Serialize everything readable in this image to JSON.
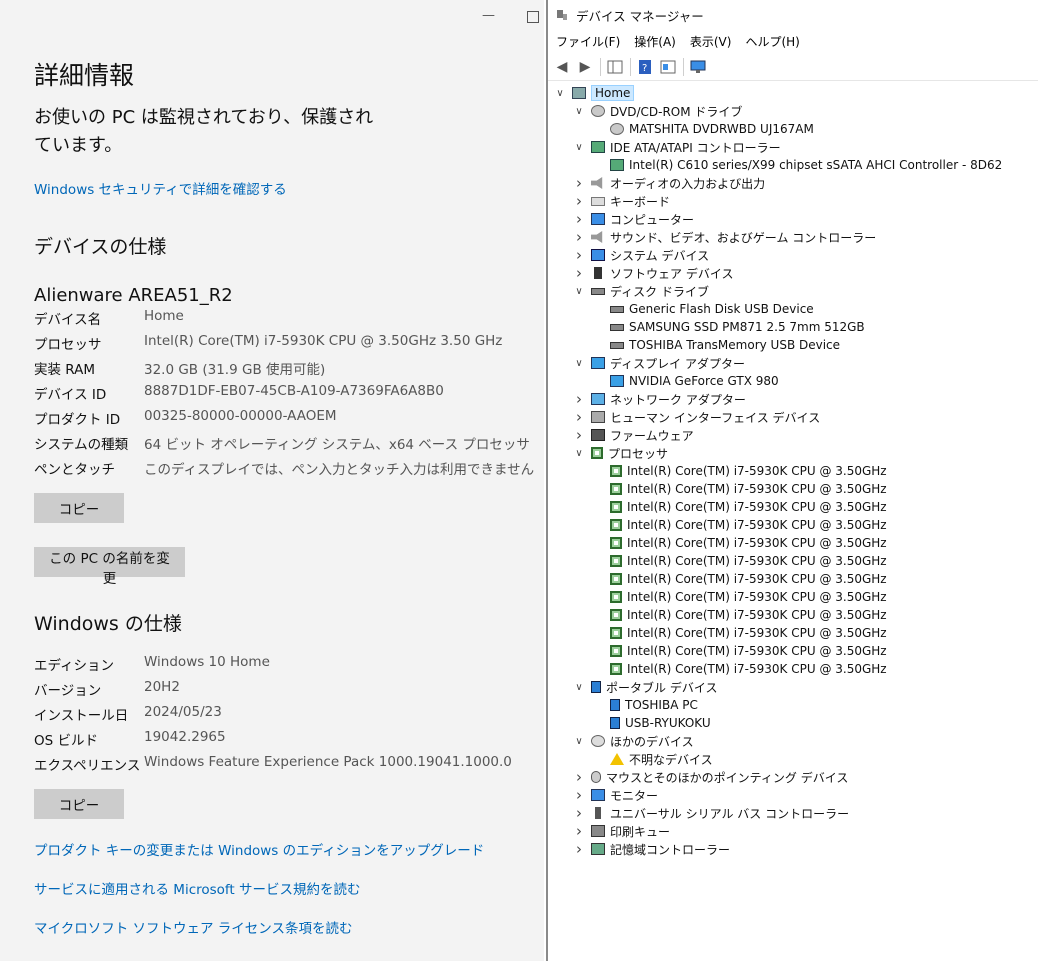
{
  "settings": {
    "title": "詳細情報",
    "status": "お使いの PC は監視されており、保護されています。",
    "security_link": "Windows セキュリティで詳細を確認する",
    "device_spec_heading": "デバイスの仕様",
    "device_model": "Alienware AREA51_R2",
    "device_specs": [
      {
        "label": "デバイス名",
        "value": "Home"
      },
      {
        "label": "プロセッサ",
        "value": "Intel(R) Core(TM) i7-5930K CPU @ 3.50GHz   3.50 GHz"
      },
      {
        "label": "実装 RAM",
        "value": "32.0 GB (31.9 GB 使用可能)"
      },
      {
        "label": "デバイス ID",
        "value": "8887D1DF-EB07-45CB-A109-A7369FA6A8B0"
      },
      {
        "label": "プロダクト ID",
        "value": "00325-80000-00000-AAOEM"
      },
      {
        "label": "システムの種類",
        "value": "64 ビット オペレーティング システム、x64 ベース プロセッサ"
      },
      {
        "label": "ペンとタッチ",
        "value": "このディスプレイでは、ペン入力とタッチ入力は利用できません"
      }
    ],
    "copy_button": "コピー",
    "rename_button": "この PC の名前を変更",
    "windows_spec_heading": "Windows の仕様",
    "windows_specs": [
      {
        "label": "エディション",
        "value": "Windows 10 Home"
      },
      {
        "label": "バージョン",
        "value": "20H2"
      },
      {
        "label": "インストール日",
        "value": "2024/05/23"
      },
      {
        "label": "OS ビルド",
        "value": "19042.2965"
      },
      {
        "label": "エクスペリエンス",
        "value": "Windows Feature Experience Pack 1000.19041.1000.0"
      }
    ],
    "copy_button_2": "コピー",
    "links": [
      "プロダクト キーの変更または Windows のエディションをアップグレード",
      "サービスに適用される Microsoft サービス規約を読む",
      "マイクロソフト ソフトウェア ライセンス条項を読む"
    ],
    "window_controls": {
      "minimize": "—"
    }
  },
  "device_manager": {
    "title": "デバイス マネージャー",
    "menu": [
      "ファイル(F)",
      "操作(A)",
      "表示(V)",
      "ヘルプ(H)"
    ],
    "tree": [
      {
        "label": "Home",
        "level": 0,
        "expander": "expanded",
        "icon": "computer-root-icon",
        "selected": true
      },
      {
        "label": "DVD/CD-ROM ドライブ",
        "level": 1,
        "expander": "expanded",
        "icon": "dvd-drive-icon"
      },
      {
        "label": "MATSHITA DVDRWBD UJ167AM",
        "level": 2,
        "expander": "none",
        "icon": "dvd-drive-icon"
      },
      {
        "label": "IDE ATA/ATAPI コントローラー",
        "level": 1,
        "expander": "expanded",
        "icon": "ide-controller-icon"
      },
      {
        "label": "Intel(R) C610 series/X99 chipset sSATA AHCI Controller - 8D62",
        "level": 2,
        "expander": "none",
        "icon": "ide-controller-icon"
      },
      {
        "label": "オーディオの入力および出力",
        "level": 1,
        "expander": "collapsed",
        "icon": "speaker-icon"
      },
      {
        "label": "キーボード",
        "level": 1,
        "expander": "collapsed",
        "icon": "keyboard-icon"
      },
      {
        "label": "コンピューター",
        "level": 1,
        "expander": "collapsed",
        "icon": "computer-icon"
      },
      {
        "label": "サウンド、ビデオ、およびゲーム コントローラー",
        "level": 1,
        "expander": "collapsed",
        "icon": "speaker-icon"
      },
      {
        "label": "システム デバイス",
        "level": 1,
        "expander": "collapsed",
        "icon": "system-device-icon"
      },
      {
        "label": "ソフトウェア デバイス",
        "level": 1,
        "expander": "collapsed",
        "icon": "software-device-icon"
      },
      {
        "label": "ディスク ドライブ",
        "level": 1,
        "expander": "expanded",
        "icon": "disk-drive-icon"
      },
      {
        "label": "Generic Flash Disk USB Device",
        "level": 2,
        "expander": "none",
        "icon": "disk-drive-icon"
      },
      {
        "label": "SAMSUNG SSD PM871 2.5 7mm 512GB",
        "level": 2,
        "expander": "none",
        "icon": "disk-drive-icon"
      },
      {
        "label": "TOSHIBA TransMemory USB Device",
        "level": 2,
        "expander": "none",
        "icon": "disk-drive-icon"
      },
      {
        "label": "ディスプレイ アダプター",
        "level": 1,
        "expander": "expanded",
        "icon": "display-adapter-icon"
      },
      {
        "label": "NVIDIA GeForce GTX 980",
        "level": 2,
        "expander": "none",
        "icon": "display-adapter-icon"
      },
      {
        "label": "ネットワーク アダプター",
        "level": 1,
        "expander": "collapsed",
        "icon": "network-adapter-icon"
      },
      {
        "label": "ヒューマン インターフェイス デバイス",
        "level": 1,
        "expander": "collapsed",
        "icon": "hid-icon"
      },
      {
        "label": "ファームウェア",
        "level": 1,
        "expander": "collapsed",
        "icon": "firmware-icon"
      },
      {
        "label": "プロセッサ",
        "level": 1,
        "expander": "expanded",
        "icon": "processor-icon"
      },
      {
        "label": "Intel(R) Core(TM) i7-5930K CPU @ 3.50GHz",
        "level": 2,
        "expander": "none",
        "icon": "processor-icon"
      },
      {
        "label": "Intel(R) Core(TM) i7-5930K CPU @ 3.50GHz",
        "level": 2,
        "expander": "none",
        "icon": "processor-icon"
      },
      {
        "label": "Intel(R) Core(TM) i7-5930K CPU @ 3.50GHz",
        "level": 2,
        "expander": "none",
        "icon": "processor-icon"
      },
      {
        "label": "Intel(R) Core(TM) i7-5930K CPU @ 3.50GHz",
        "level": 2,
        "expander": "none",
        "icon": "processor-icon"
      },
      {
        "label": "Intel(R) Core(TM) i7-5930K CPU @ 3.50GHz",
        "level": 2,
        "expander": "none",
        "icon": "processor-icon"
      },
      {
        "label": "Intel(R) Core(TM) i7-5930K CPU @ 3.50GHz",
        "level": 2,
        "expander": "none",
        "icon": "processor-icon"
      },
      {
        "label": "Intel(R) Core(TM) i7-5930K CPU @ 3.50GHz",
        "level": 2,
        "expander": "none",
        "icon": "processor-icon"
      },
      {
        "label": "Intel(R) Core(TM) i7-5930K CPU @ 3.50GHz",
        "level": 2,
        "expander": "none",
        "icon": "processor-icon"
      },
      {
        "label": "Intel(R) Core(TM) i7-5930K CPU @ 3.50GHz",
        "level": 2,
        "expander": "none",
        "icon": "processor-icon"
      },
      {
        "label": "Intel(R) Core(TM) i7-5930K CPU @ 3.50GHz",
        "level": 2,
        "expander": "none",
        "icon": "processor-icon"
      },
      {
        "label": "Intel(R) Core(TM) i7-5930K CPU @ 3.50GHz",
        "level": 2,
        "expander": "none",
        "icon": "processor-icon"
      },
      {
        "label": "Intel(R) Core(TM) i7-5930K CPU @ 3.50GHz",
        "level": 2,
        "expander": "none",
        "icon": "processor-icon"
      },
      {
        "label": "ポータブル デバイス",
        "level": 1,
        "expander": "expanded",
        "icon": "portable-device-icon"
      },
      {
        "label": "TOSHIBA PC",
        "level": 2,
        "expander": "none",
        "icon": "portable-device-icon"
      },
      {
        "label": "USB-RYUKOKU",
        "level": 2,
        "expander": "none",
        "icon": "portable-device-icon"
      },
      {
        "label": "ほかのデバイス",
        "level": 1,
        "expander": "expanded",
        "icon": "other-device-icon"
      },
      {
        "label": "不明なデバイス",
        "level": 2,
        "expander": "none",
        "icon": "warning-icon"
      },
      {
        "label": "マウスとそのほかのポインティング デバイス",
        "level": 1,
        "expander": "collapsed",
        "icon": "mouse-icon"
      },
      {
        "label": "モニター",
        "level": 1,
        "expander": "collapsed",
        "icon": "monitor-icon"
      },
      {
        "label": "ユニバーサル シリアル バス コントローラー",
        "level": 1,
        "expander": "collapsed",
        "icon": "usb-icon"
      },
      {
        "label": "印刷キュー",
        "level": 1,
        "expander": "collapsed",
        "icon": "printer-icon"
      },
      {
        "label": "記憶域コントローラー",
        "level": 1,
        "expander": "collapsed",
        "icon": "storage-controller-icon"
      }
    ]
  }
}
